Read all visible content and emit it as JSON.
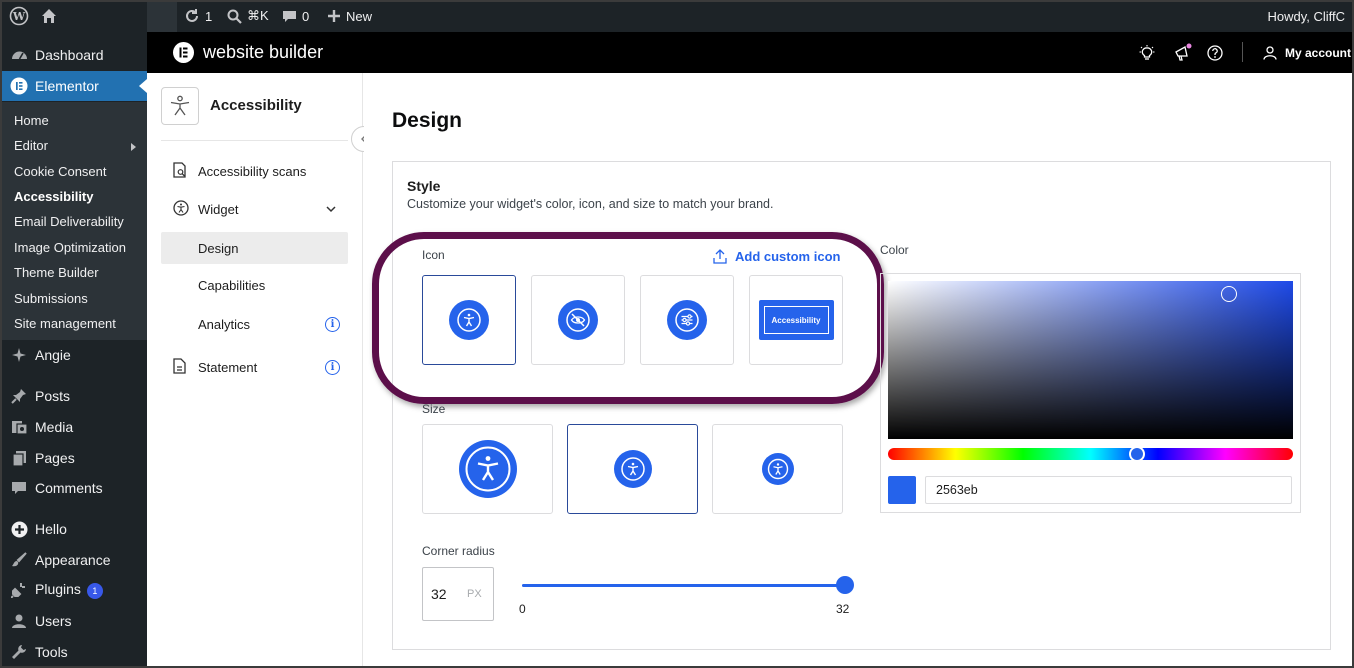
{
  "adminbar": {
    "updates_count": "1",
    "search_shortcut": "⌘K",
    "comments_count": "0",
    "new_label": "New",
    "howdy": "Howdy, CliffC"
  },
  "wp_menu": {
    "dashboard": "Dashboard",
    "elementor": "Elementor",
    "submenu": [
      "Home",
      "Editor",
      "Cookie Consent",
      "Accessibility",
      "Email Deliverability",
      "Image Optimization",
      "Theme Builder",
      "Submissions",
      "Site management"
    ],
    "angie": "Angie",
    "posts": "Posts",
    "media": "Media",
    "pages": "Pages",
    "comments": "Comments",
    "hello": "Hello",
    "appearance": "Appearance",
    "plugins": "Plugins",
    "plugins_badge": "1",
    "users": "Users",
    "tools": "Tools"
  },
  "header": {
    "brand": "website builder",
    "account": "My account"
  },
  "nav": {
    "title": "Accessibility",
    "scans": "Accessibility scans",
    "widget": "Widget",
    "design": "Design",
    "capabilities": "Capabilities",
    "analytics": "Analytics",
    "statement": "Statement",
    "info_glyph": "i"
  },
  "main": {
    "title": "Design",
    "style_title": "Style",
    "style_desc": "Customize your widget's color, icon, and size to match your brand.",
    "icon_label": "Icon",
    "add_custom_icon": "Add custom icon",
    "icon_option_text": "Accessibility",
    "size_label": "Size",
    "color_label": "Color",
    "hex_value": "2563eb",
    "corner_radius_label": "Corner radius",
    "radius_value": "32",
    "radius_unit": "PX",
    "slider_min": "0",
    "slider_max": "32",
    "slider_value": 32
  },
  "colors": {
    "accent": "#2563eb",
    "highlight_ring": "#5c0f4a",
    "admin_bg": "#1d2327",
    "active_menu": "#2271b1"
  }
}
